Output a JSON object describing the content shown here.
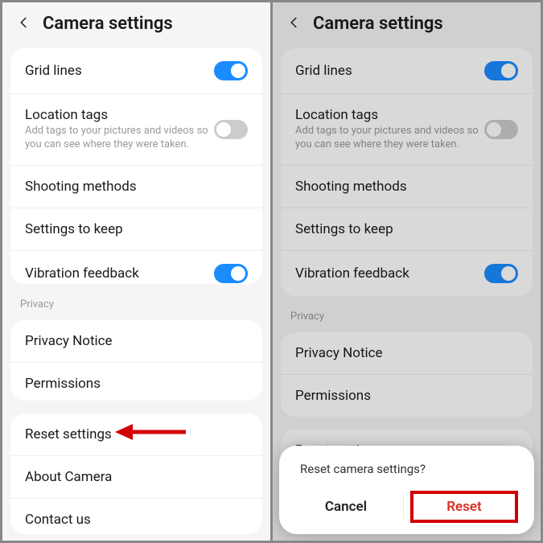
{
  "left": {
    "header": {
      "title": "Camera settings"
    },
    "group1": {
      "grid_lines": {
        "label": "Grid lines",
        "on": true
      },
      "location_tags": {
        "label": "Location tags",
        "desc": "Add tags to your pictures and videos so you can see where they were taken.",
        "on": false
      },
      "shooting_methods": {
        "label": "Shooting methods"
      },
      "settings_to_keep": {
        "label": "Settings to keep"
      },
      "vibration_feedback": {
        "label": "Vibration feedback",
        "on": true
      }
    },
    "privacy_label": "Privacy",
    "group2": {
      "privacy_notice": {
        "label": "Privacy Notice"
      },
      "permissions": {
        "label": "Permissions"
      }
    },
    "group3": {
      "reset_settings": {
        "label": "Reset settings"
      },
      "about_camera": {
        "label": "About Camera"
      },
      "contact_us": {
        "label": "Contact us"
      }
    }
  },
  "right": {
    "header": {
      "title": "Camera settings"
    },
    "group1": {
      "grid_lines": {
        "label": "Grid lines",
        "on": true
      },
      "location_tags": {
        "label": "Location tags",
        "desc": "Add tags to your pictures and videos so you can see where they were taken.",
        "on": false
      },
      "shooting_methods": {
        "label": "Shooting methods"
      },
      "settings_to_keep": {
        "label": "Settings to keep"
      },
      "vibration_feedback": {
        "label": "Vibration feedback",
        "on": true
      }
    },
    "privacy_label": "Privacy",
    "group2": {
      "privacy_notice": {
        "label": "Privacy Notice"
      },
      "permissions": {
        "label": "Permissions"
      }
    },
    "group3": {
      "reset_settings": {
        "label": "Reset settings"
      }
    },
    "dialog": {
      "title": "Reset camera settings?",
      "cancel": "Cancel",
      "reset": "Reset"
    }
  }
}
